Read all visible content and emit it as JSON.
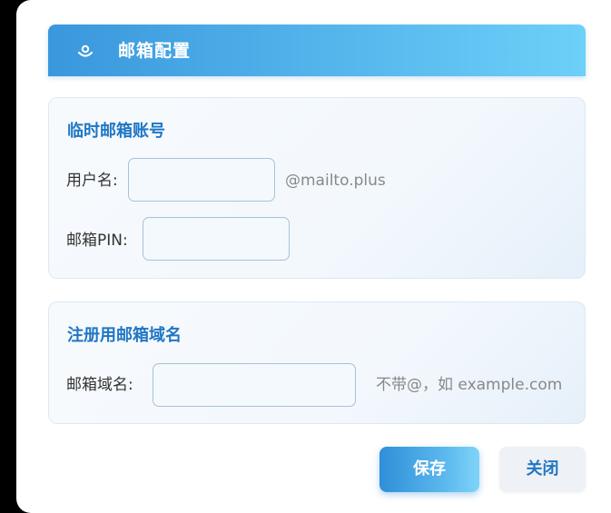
{
  "dialog": {
    "title": "邮箱配置",
    "icon": "mail-icon"
  },
  "temp_account": {
    "title": "临时邮箱账号",
    "username_label": "用户名:",
    "username_value": "",
    "username_suffix": "@mailto.plus",
    "pin_label": "邮箱PIN:",
    "pin_value": ""
  },
  "domain": {
    "title": "注册用邮箱域名",
    "domain_label": "邮箱域名:",
    "domain_value": "",
    "domain_hint": "不带@，如 example.com"
  },
  "buttons": {
    "save": "保存",
    "close": "关闭"
  },
  "colors": {
    "accent": "#1f76c4",
    "header_start": "#3a97dc",
    "header_end": "#6dd0f8"
  }
}
